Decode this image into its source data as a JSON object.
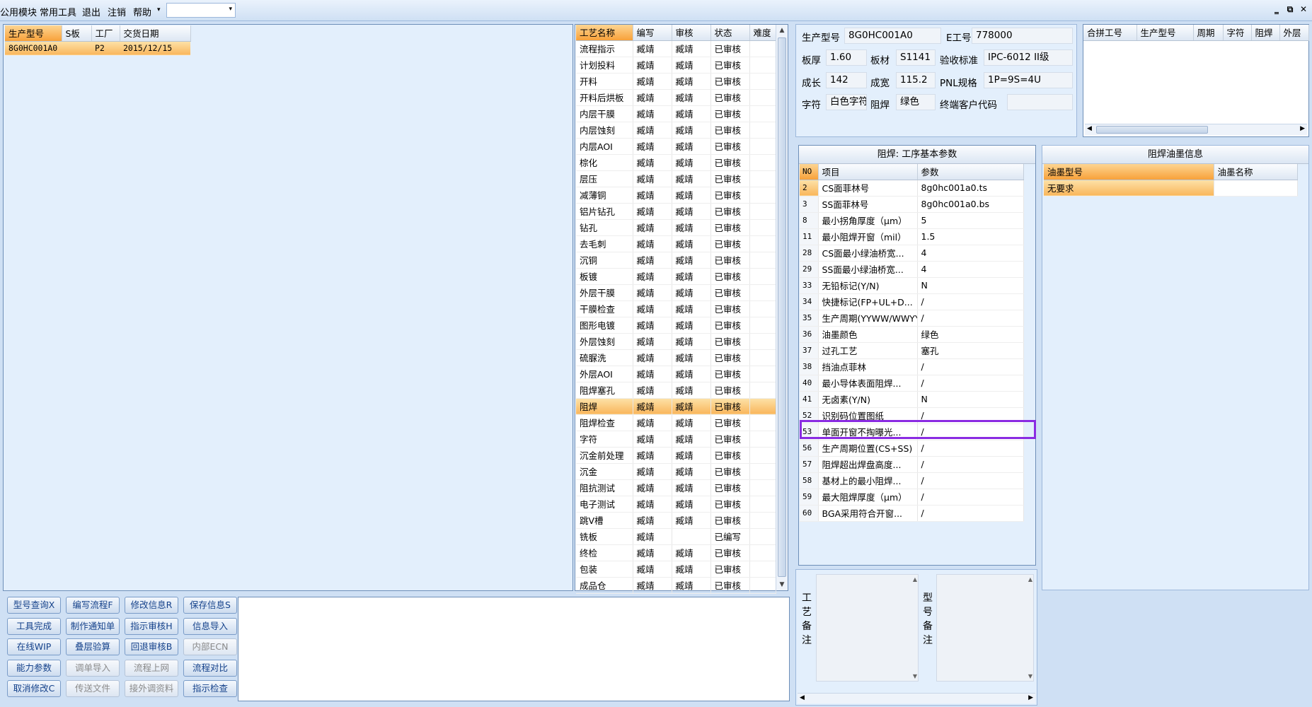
{
  "menu": {
    "items": [
      "公用模块",
      "常用工具",
      "退出",
      "注销",
      "帮助"
    ],
    "dropdown_arrow": "▾",
    "combo_value": "",
    "combo_arrow": "▾",
    "window_controls": [
      "‗",
      "⧉",
      "✕"
    ]
  },
  "model_list": {
    "columns": [
      "生产型号",
      "S板",
      "工厂",
      "交货日期"
    ],
    "rows": [
      [
        "8G0HC001A0",
        "",
        "P2",
        "2015/12/15"
      ]
    ]
  },
  "process_list": {
    "columns": [
      "工艺名称",
      "编写",
      "审核",
      "状态",
      "难度"
    ],
    "rows": [
      [
        "流程指示",
        "臧靖",
        "臧靖",
        "已审核",
        ""
      ],
      [
        "计划投料",
        "臧靖",
        "臧靖",
        "已审核",
        ""
      ],
      [
        "开料",
        "臧靖",
        "臧靖",
        "已审核",
        ""
      ],
      [
        "开料后烘板",
        "臧靖",
        "臧靖",
        "已审核",
        ""
      ],
      [
        "内层干膜",
        "臧靖",
        "臧靖",
        "已审核",
        ""
      ],
      [
        "内层蚀刻",
        "臧靖",
        "臧靖",
        "已审核",
        ""
      ],
      [
        "内层AOI",
        "臧靖",
        "臧靖",
        "已审核",
        ""
      ],
      [
        "棕化",
        "臧靖",
        "臧靖",
        "已审核",
        ""
      ],
      [
        "层压",
        "臧靖",
        "臧靖",
        "已审核",
        ""
      ],
      [
        "减薄铜",
        "臧靖",
        "臧靖",
        "已审核",
        ""
      ],
      [
        "铝片钻孔",
        "臧靖",
        "臧靖",
        "已审核",
        ""
      ],
      [
        "钻孔",
        "臧靖",
        "臧靖",
        "已审核",
        ""
      ],
      [
        "去毛刺",
        "臧靖",
        "臧靖",
        "已审核",
        ""
      ],
      [
        "沉铜",
        "臧靖",
        "臧靖",
        "已审核",
        ""
      ],
      [
        "板镀",
        "臧靖",
        "臧靖",
        "已审核",
        ""
      ],
      [
        "外层干膜",
        "臧靖",
        "臧靖",
        "已审核",
        ""
      ],
      [
        "干膜检查",
        "臧靖",
        "臧靖",
        "已审核",
        ""
      ],
      [
        "图形电镀",
        "臧靖",
        "臧靖",
        "已审核",
        ""
      ],
      [
        "外层蚀刻",
        "臧靖",
        "臧靖",
        "已审核",
        ""
      ],
      [
        "硫脲洗",
        "臧靖",
        "臧靖",
        "已审核",
        ""
      ],
      [
        "外层AOI",
        "臧靖",
        "臧靖",
        "已审核",
        ""
      ],
      [
        "阻焊塞孔",
        "臧靖",
        "臧靖",
        "已审核",
        ""
      ],
      [
        "阻焊",
        "臧靖",
        "臧靖",
        "已审核",
        ""
      ],
      [
        "阻焊检查",
        "臧靖",
        "臧靖",
        "已审核",
        ""
      ],
      [
        "字符",
        "臧靖",
        "臧靖",
        "已审核",
        ""
      ],
      [
        "沉金前处理",
        "臧靖",
        "臧靖",
        "已审核",
        ""
      ],
      [
        "沉金",
        "臧靖",
        "臧靖",
        "已审核",
        ""
      ],
      [
        "阻抗测试",
        "臧靖",
        "臧靖",
        "已审核",
        ""
      ],
      [
        "电子测试",
        "臧靖",
        "臧靖",
        "已审核",
        ""
      ],
      [
        "跳V槽",
        "臧靖",
        "臧靖",
        "已审核",
        ""
      ],
      [
        "铣板",
        "臧靖",
        "",
        "已编写",
        ""
      ],
      [
        "终检",
        "臧靖",
        "臧靖",
        "已审核",
        ""
      ],
      [
        "包装",
        "臧靖",
        "臧靖",
        "已审核",
        ""
      ],
      [
        "成品仓",
        "臧靖",
        "臧靖",
        "已审核",
        ""
      ]
    ],
    "selected_index": 22
  },
  "info": {
    "model_label": "生产型号",
    "model_value": "8G0HC001A0",
    "job_label": "E工号",
    "job_value": "778000",
    "thickness_label": "板厚",
    "thickness_value": "1.60",
    "material_label": "板材",
    "material_value": "S1141",
    "standard_label": "验收标准",
    "standard_value": "IPC-6012 II级",
    "length_label": "成长",
    "length_value": "142",
    "width_label": "成宽",
    "width_value": "115.2",
    "pnl_label": "PNL规格",
    "pnl_value": "1P=9S=4U",
    "char_label": "字符",
    "char_value": "白色字符",
    "mask_label": "阻焊",
    "mask_value": "绿色",
    "customer_label": "终端客户代码",
    "customer_value": ""
  },
  "merge_list": {
    "columns": [
      "合拼工号",
      "生产型号",
      "周期",
      "字符",
      "阻焊",
      "外层"
    ]
  },
  "params": {
    "title": "阻焊: 工序基本参数",
    "columns": [
      "NO",
      "项目",
      "参数"
    ],
    "rows": [
      [
        "2",
        "CS面菲林号",
        "8g0hc001a0.ts"
      ],
      [
        "3",
        "SS面菲林号",
        "8g0hc001a0.bs"
      ],
      [
        "8",
        "最小拐角厚度（μm）",
        "5"
      ],
      [
        "11",
        "最小阻焊开窗（mil）",
        "1.5"
      ],
      [
        "28",
        "CS面最小绿油桥宽...",
        "4"
      ],
      [
        "29",
        "SS面最小绿油桥宽...",
        "4"
      ],
      [
        "33",
        "无铅标记(Y/N)",
        "N"
      ],
      [
        "34",
        "快捷标记(FP+UL+D...",
        "/"
      ],
      [
        "35",
        "生产周期(YYWW/WWYY)",
        "/"
      ],
      [
        "36",
        "油墨颜色",
        "绿色"
      ],
      [
        "37",
        "过孔工艺",
        "塞孔"
      ],
      [
        "38",
        "挡油点菲林",
        "/"
      ],
      [
        "40",
        "最小导体表面阻焊...",
        "/"
      ],
      [
        "41",
        "无卤素(Y/N)",
        "N"
      ],
      [
        "52",
        "识别码位置图纸",
        "/"
      ],
      [
        "53",
        "单面开窗不掏曝光...",
        "/"
      ],
      [
        "56",
        "生产周期位置(CS+SS)",
        "/"
      ],
      [
        "57",
        "阻焊超出焊盘高度...",
        "/"
      ],
      [
        "58",
        "基材上的最小阻焊...",
        "/"
      ],
      [
        "59",
        "最大阻焊厚度（μm）",
        "/"
      ],
      [
        "60",
        "BGA采用符合开窗...",
        "/"
      ]
    ],
    "selected_index": 0,
    "highlight_index": 15
  },
  "ink": {
    "title": "阻焊油墨信息",
    "columns": [
      "油墨型号",
      "油墨名称"
    ],
    "rows": [
      [
        "无要求",
        ""
      ]
    ]
  },
  "remarks": {
    "process_label": "工艺备注",
    "model_label": "型号备注",
    "process_text": "",
    "model_text": ""
  },
  "buttons": [
    {
      "label": "型号查询X",
      "enabled": true
    },
    {
      "label": "编写流程F",
      "enabled": true
    },
    {
      "label": "修改信息R",
      "enabled": true
    },
    {
      "label": "保存信息S",
      "enabled": true
    },
    {
      "label": "工具完成",
      "enabled": true
    },
    {
      "label": "制作通知单",
      "enabled": true
    },
    {
      "label": "指示审核H",
      "enabled": true
    },
    {
      "label": "信息导入",
      "enabled": true
    },
    {
      "label": "在线WIP",
      "enabled": true
    },
    {
      "label": "叠层验算",
      "enabled": true
    },
    {
      "label": "回退审核B",
      "enabled": true
    },
    {
      "label": "内部ECN",
      "enabled": false
    },
    {
      "label": "能力参数",
      "enabled": true
    },
    {
      "label": "调单导入",
      "enabled": false
    },
    {
      "label": "流程上网",
      "enabled": false
    },
    {
      "label": "流程对比",
      "enabled": true
    },
    {
      "label": "取消修改C",
      "enabled": true
    },
    {
      "label": "传送文件",
      "enabled": false
    },
    {
      "label": "接外调资料",
      "enabled": false
    },
    {
      "label": "指示检查",
      "enabled": true
    }
  ],
  "colors": {
    "selection": "#f9b65c",
    "highlight_border": "#8a2be2",
    "panel_background": "#e3effc",
    "button_text": "#15428b"
  }
}
